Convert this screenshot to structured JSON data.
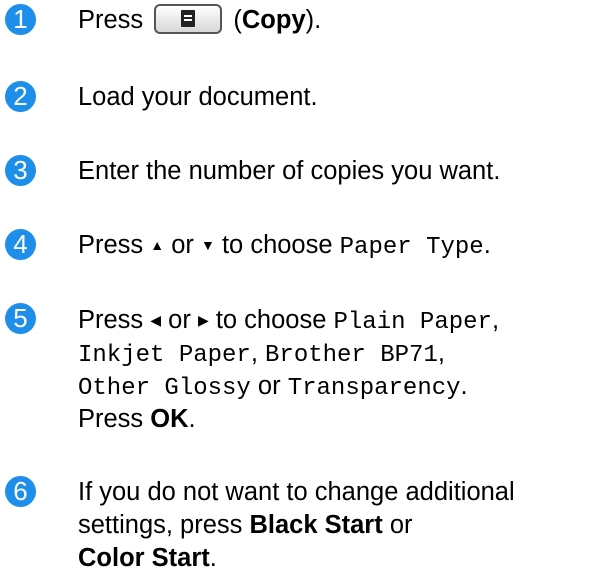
{
  "colors": {
    "step_badge": "#1d8fea"
  },
  "steps": [
    {
      "num": "1",
      "t1": "Press",
      "key_icon": "copy-key-icon",
      "t2": "(",
      "b1": "Copy",
      "t3": ")."
    },
    {
      "num": "2",
      "text": "Load your document."
    },
    {
      "num": "3",
      "text": "Enter the number of copies you want."
    },
    {
      "num": "4",
      "t1": "Press",
      "up": "▲",
      "t2": "or",
      "down": "▼",
      "t3": "to choose",
      "m1": "Paper Type",
      "t4": "."
    },
    {
      "num": "5",
      "t1": "Press",
      "left": "◀",
      "t2": "or",
      "right": "▶",
      "t3": "to choose",
      "m1": "Plain Paper",
      "c1": ",",
      "m2": "Inkjet Paper",
      "c2": ",",
      "m3": "Brother BP71",
      "c3": ",",
      "m4": "Other Glossy",
      "t4": "or",
      "m5": "Transparency",
      "t5": ".",
      "t6": "Press",
      "b1": "OK",
      "t7": "."
    },
    {
      "num": "6",
      "t1": "If you do not want to change additional",
      "t2": "settings, press",
      "b1": "Black Start",
      "t3": "or",
      "b2": "Color Start",
      "t4": "."
    }
  ]
}
